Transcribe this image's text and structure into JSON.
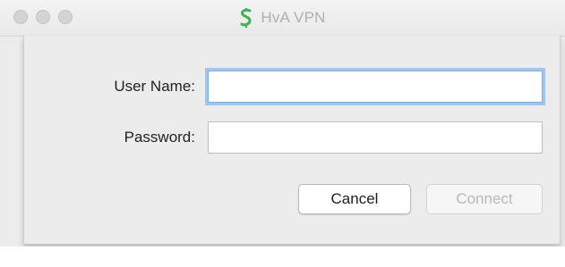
{
  "window": {
    "title": "HvA VPN",
    "app_icon": "hva-vpn-logo-icon",
    "accent_color": "#3fb14f"
  },
  "form": {
    "username_label": "User Name:",
    "username_value": "",
    "password_label": "Password:",
    "password_value": ""
  },
  "buttons": {
    "cancel_label": "Cancel",
    "connect_label": "Connect",
    "connect_enabled": false
  },
  "colors": {
    "focus_ring": "#9ec6f1",
    "disabled_text": "#b8b8b8"
  }
}
